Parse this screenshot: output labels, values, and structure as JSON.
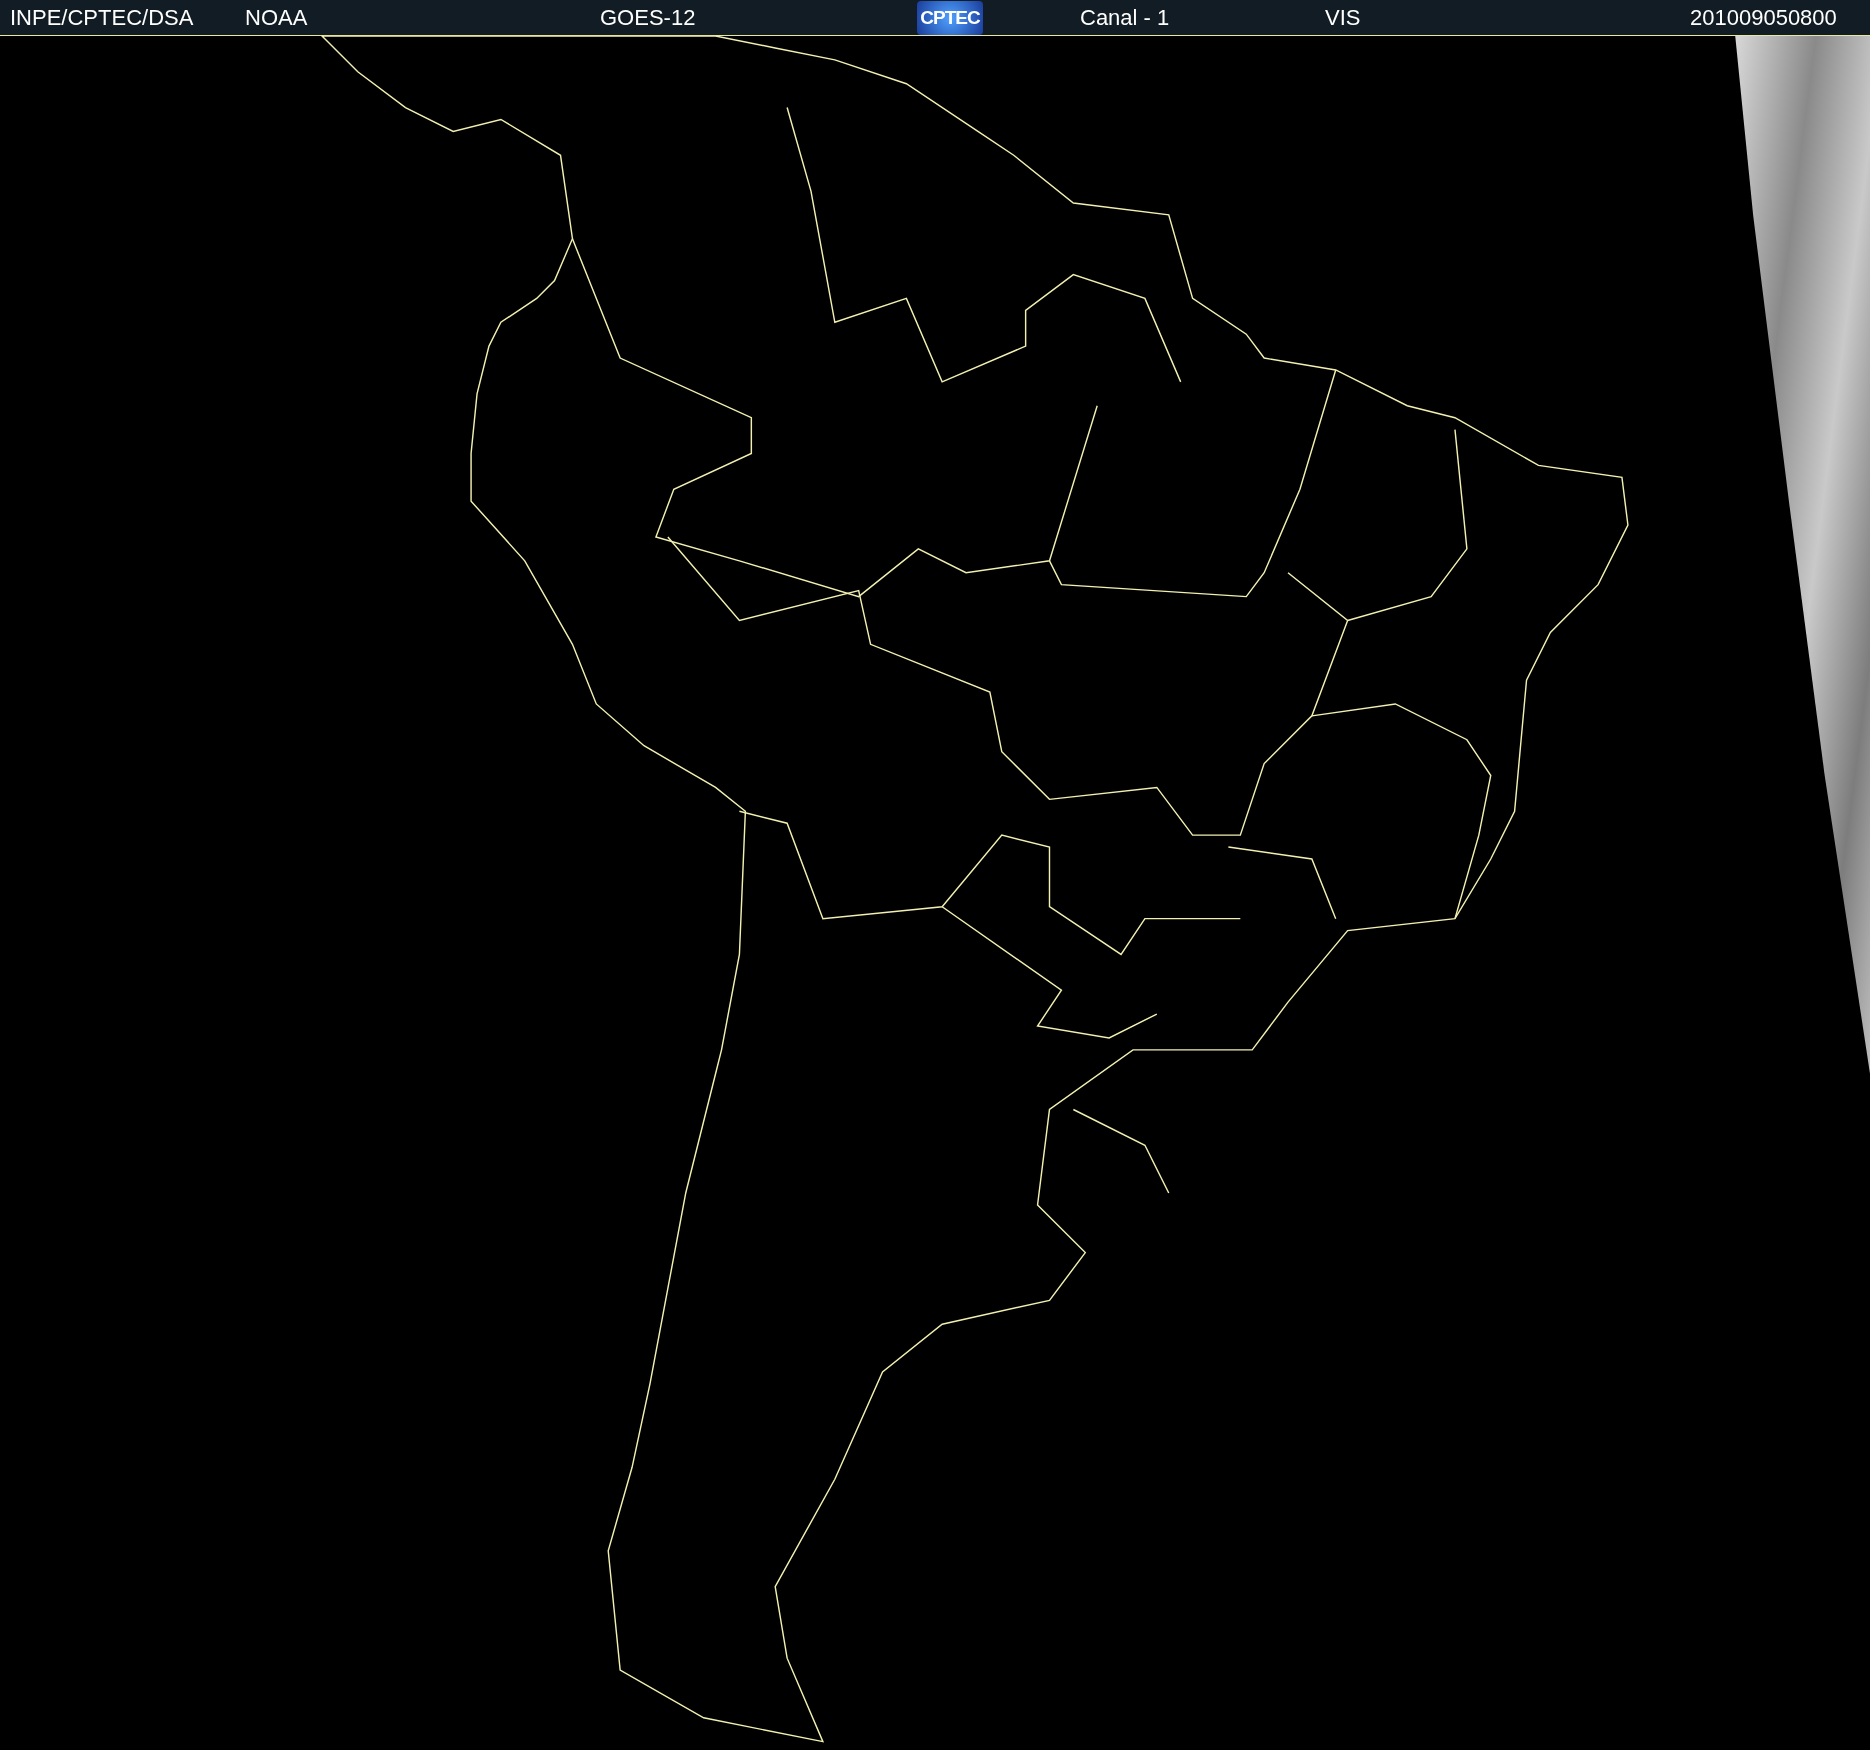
{
  "header": {
    "items": [
      {
        "kind": "text",
        "text": "INPE/CPTEC/DSA"
      },
      {
        "kind": "text",
        "text": "NOAA"
      },
      {
        "kind": "text",
        "text": "GOES-12"
      },
      {
        "kind": "logo",
        "text": "CPTEC"
      },
      {
        "kind": "text",
        "text": "Canal - 1"
      },
      {
        "kind": "text",
        "text": "VIS"
      },
      {
        "kind": "text",
        "text": "201009050800"
      }
    ]
  }
}
